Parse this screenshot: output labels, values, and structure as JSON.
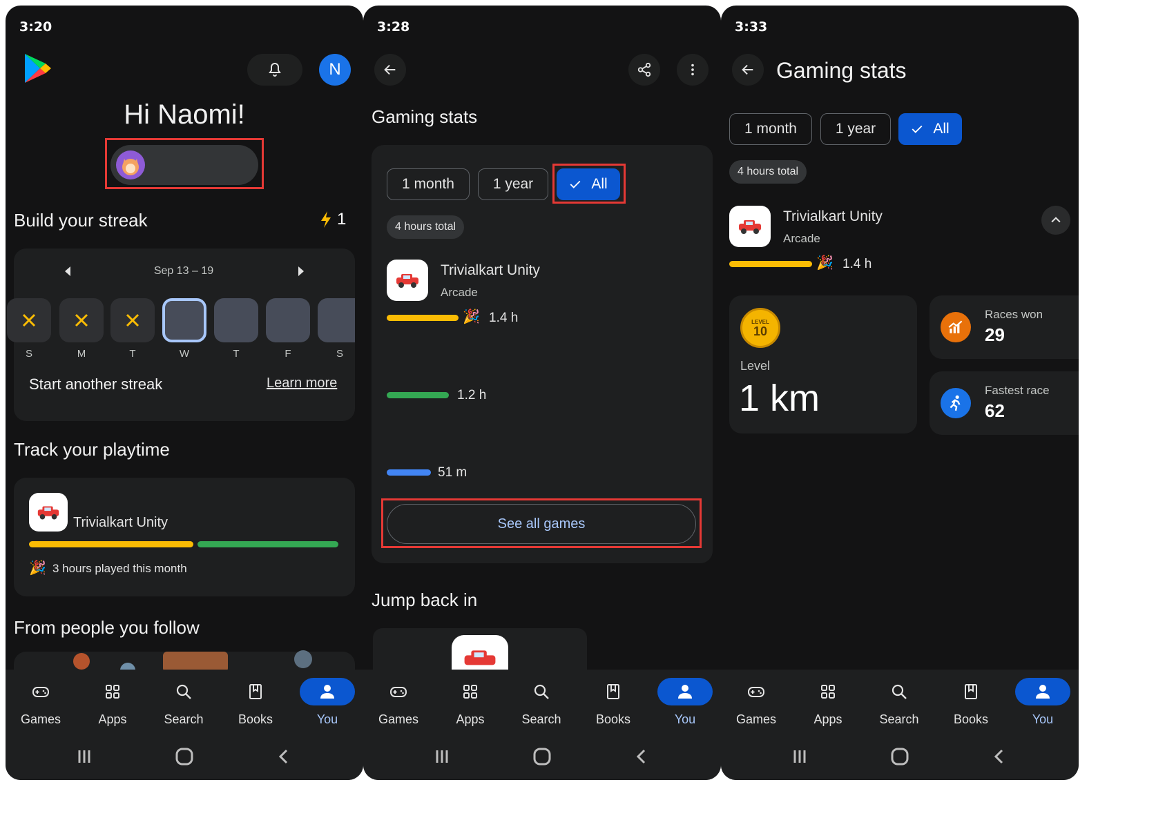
{
  "screen1": {
    "time": "3:20",
    "avatar_letter": "N",
    "greeting": "Hi Naomi!",
    "streak": {
      "title": "Build your streak",
      "count": "1",
      "week": "Sep 13 – 19",
      "days": [
        "S",
        "M",
        "T",
        "W",
        "T",
        "F",
        "S"
      ],
      "message": "Start another streak",
      "learn_more": "Learn more"
    },
    "playtime": {
      "title": "Track your playtime",
      "game": "Trivialkart Unity",
      "note": "3 hours played this month"
    },
    "follow_title": "From people you follow"
  },
  "screen2": {
    "time": "3:28",
    "title": "Gaming stats",
    "filters": [
      "1 month",
      "1 year",
      "All"
    ],
    "total": "4 hours total",
    "game": {
      "name": "Trivialkart Unity",
      "genre": "Arcade"
    },
    "bars": [
      {
        "label": "1.4 h",
        "color": "#fbbc04"
      },
      {
        "label": "1.2 h",
        "color": "#34a853"
      },
      {
        "label": "51 m",
        "color": "#4285f4"
      }
    ],
    "see_all": "See all games",
    "jump_back": "Jump back in"
  },
  "screen3": {
    "time": "3:33",
    "title": "Gaming stats",
    "filters": [
      "1 month",
      "1 year",
      "All"
    ],
    "total": "4 hours total",
    "game": {
      "name": "Trivialkart Unity",
      "genre": "Arcade",
      "hours": "1.4 h"
    },
    "level": {
      "badge": "10",
      "badge_text": "LEVEL",
      "label": "Level",
      "value": "1 km"
    },
    "races_won": {
      "label": "Races won",
      "value": "29"
    },
    "fastest_race": {
      "label": "Fastest race",
      "value": "62"
    }
  },
  "nav": [
    "Games",
    "Apps",
    "Search",
    "Books",
    "You"
  ],
  "colors": {
    "accent": "#0b57d0",
    "background": "#131314",
    "card": "#1e1f20",
    "highlight": "#e53935"
  }
}
